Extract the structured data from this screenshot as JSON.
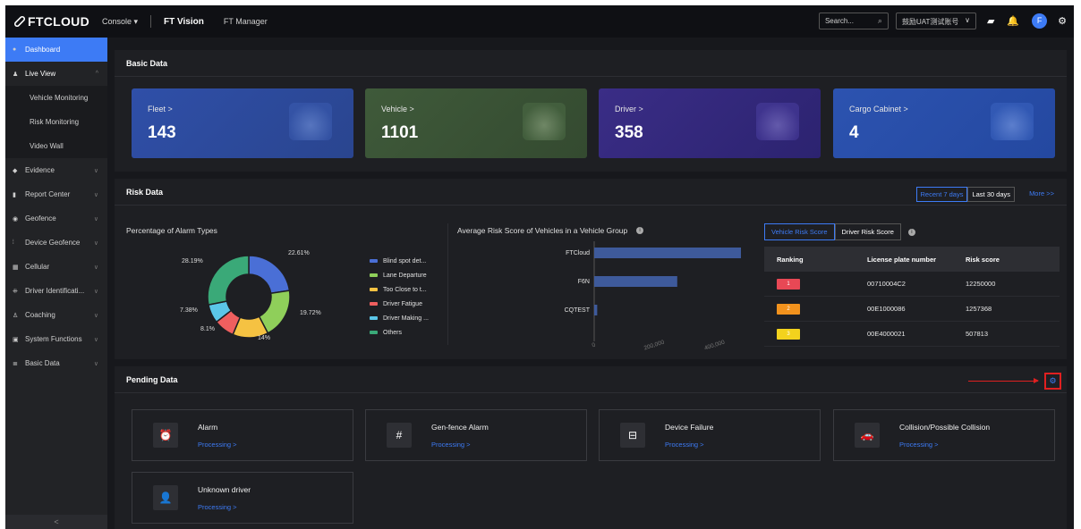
{
  "header": {
    "logo": "FTCLOUD",
    "console": "Console ▾",
    "nav": [
      "FT Vision",
      "FT Manager"
    ],
    "search_placeholder": "Search...",
    "account": "鼓励UAT测试账号",
    "avatar_initial": "F"
  },
  "sidebar": {
    "items": [
      {
        "label": "Dashboard",
        "icon": "dashboard-icon"
      },
      {
        "label": "Live View",
        "icon": "live-view-icon"
      },
      {
        "label": "Vehicle Monitoring"
      },
      {
        "label": "Risk Monitoring"
      },
      {
        "label": "Video Wall"
      },
      {
        "label": "Evidence",
        "icon": "evidence-icon"
      },
      {
        "label": "Report Center",
        "icon": "report-icon"
      },
      {
        "label": "Geofence",
        "icon": "geofence-icon"
      },
      {
        "label": "Device Geofence",
        "icon": "device-geofence-icon"
      },
      {
        "label": "Cellular",
        "icon": "cellular-icon"
      },
      {
        "label": "Driver Identificati...",
        "icon": "driver-id-icon"
      },
      {
        "label": "Coaching",
        "icon": "coaching-icon"
      },
      {
        "label": "System Functions",
        "icon": "system-icon"
      },
      {
        "label": "Basic Data",
        "icon": "basic-data-icon"
      }
    ],
    "collapse": "<"
  },
  "basic_data": {
    "title": "Basic Data",
    "cards": [
      {
        "label": "Fleet >",
        "value": "143"
      },
      {
        "label": "Vehicle >",
        "value": "1101"
      },
      {
        "label": "Driver >",
        "value": "358"
      },
      {
        "label": "Cargo Cabinet >",
        "value": "4"
      }
    ]
  },
  "risk_data": {
    "title": "Risk Data",
    "range_tabs": [
      "Recent 7 days",
      "Last 30 days"
    ],
    "more": "More >>",
    "alarm_types_title": "Percentage of Alarm Types",
    "avg_risk_title": "Average Risk Score of Vehicles in a Vehicle Group",
    "risk_tabs": [
      "Vehicle Risk Score",
      "Driver Risk Score"
    ],
    "table": {
      "headers": [
        "Ranking",
        "License plate number",
        "Risk score"
      ],
      "rows": [
        {
          "rank": "1",
          "plate": "00710004C2",
          "score": "12250000",
          "color": "#e84855"
        },
        {
          "rank": "2",
          "plate": "00E1000086",
          "score": "1257368",
          "color": "#f2921d"
        },
        {
          "rank": "3",
          "plate": "00E4000021",
          "score": "507813",
          "color": "#f3d21d"
        }
      ]
    }
  },
  "chart_data": [
    {
      "type": "pie",
      "title": "Percentage of Alarm Types",
      "labels": [
        "Blind spot det...",
        "Lane Departure",
        "Too Close to t...",
        "Driver Fatigue",
        "Driver Making ...",
        "Others"
      ],
      "values": [
        22.61,
        19.72,
        14,
        8.1,
        7.38,
        28.19
      ],
      "value_labels": [
        "22.61%",
        "19.72%",
        "14%",
        "8.1%",
        "7.38%",
        "28.19%"
      ],
      "colors": [
        "#4a6fd6",
        "#8fcf5a",
        "#f5c242",
        "#ef5f5f",
        "#5bc6e8",
        "#3aa978"
      ]
    },
    {
      "type": "bar",
      "orientation": "horizontal",
      "title": "Average Risk Score of Vehicles in a Vehicle Group",
      "categories": [
        "FTCloud",
        "F6N",
        "CQTEST"
      ],
      "values": [
        780000,
        275000,
        10000
      ],
      "xlim": [
        0,
        800000
      ],
      "ticks": [
        "0",
        "200,000",
        "400,000",
        "600,000",
        "800,000"
      ],
      "color": "#3e5a9b"
    }
  ],
  "pending": {
    "title": "Pending Data",
    "cards": [
      {
        "title": "Alarm",
        "link": "Processing >",
        "icon": "alarm-icon",
        "glyph": "⏰"
      },
      {
        "title": "Gen-fence Alarm",
        "link": "Processing >",
        "icon": "fence-icon",
        "glyph": "#"
      },
      {
        "title": "Device Failure",
        "link": "Processing >",
        "icon": "device-failure-icon",
        "glyph": "⊟"
      },
      {
        "title": "Collision/Possible Collision",
        "link": "Processing >",
        "icon": "collision-icon",
        "glyph": "🚗"
      },
      {
        "title": "Unknown driver",
        "link": "Processing >",
        "icon": "unknown-driver-icon",
        "glyph": "👤"
      }
    ]
  }
}
